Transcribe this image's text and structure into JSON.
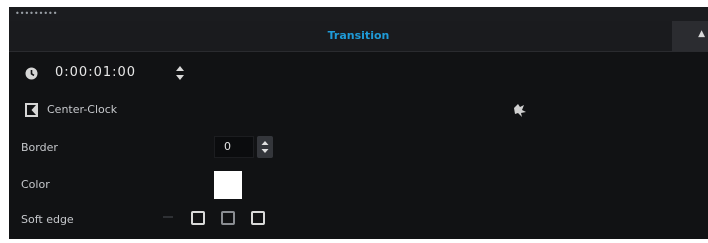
{
  "panel": {
    "title": "Transition"
  },
  "timecode": {
    "value": "0:00:01:00"
  },
  "effect": {
    "name": "Center-Clock"
  },
  "border": {
    "label": "Border",
    "value": "0"
  },
  "color": {
    "label": "Color",
    "value": "#ffffff"
  },
  "soft_edge": {
    "label": "Soft edge",
    "options": [
      "soft-edge-none",
      "soft-edge-medium",
      "soft-edge-high"
    ]
  },
  "colors": {
    "title_accent": "#1f9bd8",
    "panel_bg": "#111214"
  }
}
